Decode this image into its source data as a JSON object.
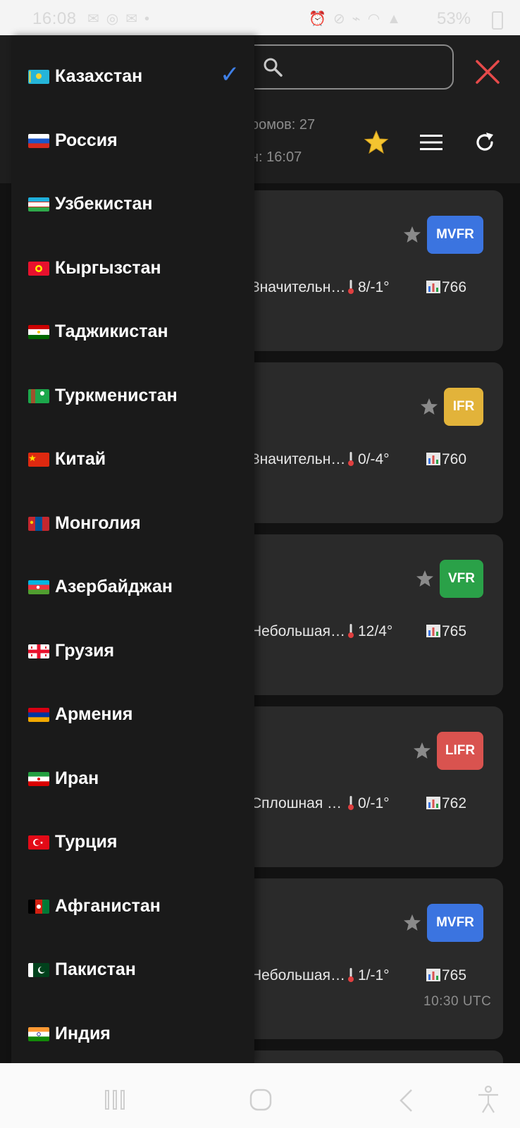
{
  "status_bar": {
    "time": "16:08",
    "battery": "53%",
    "left_icons": [
      "mail-icon",
      "instagram-icon",
      "message-icon",
      "dot-icon"
    ],
    "right_icons": [
      "alarm-icon",
      "no-sound-icon",
      "wifi-calling-icon",
      "wifi-icon",
      "signal-icon"
    ]
  },
  "header": {
    "search_value": "",
    "info_line1": "ромов: 27",
    "info_line2": "н: 16:07",
    "colors": {
      "favorite_star": "#f4c430",
      "close": "#e64a4a"
    }
  },
  "cards": [
    {
      "badge": "MVFR",
      "badge_color": "#3b74e0",
      "desc": "Значительн…",
      "temp": "8/-1°",
      "pressure": "766",
      "utc": ""
    },
    {
      "badge": "IFR",
      "badge_color": "#e2b33a",
      "desc": "Значительн…",
      "temp": "0/-4°",
      "pressure": "760",
      "utc": ""
    },
    {
      "badge": "VFR",
      "badge_color": "#2aa148",
      "desc": "Небольшая…",
      "temp": "12/4°",
      "pressure": "765",
      "utc": ""
    },
    {
      "badge": "LIFR",
      "badge_color": "#d9534f",
      "desc": "Сплошная …",
      "temp": "0/-1°",
      "pressure": "762",
      "utc": ""
    },
    {
      "badge": "MVFR",
      "badge_color": "#3b74e0",
      "desc": "Небольшая…",
      "temp": "1/-1°",
      "pressure": "765",
      "utc": "10:30 UTC"
    }
  ],
  "drawer": {
    "selected_index": 0,
    "check_color": "#3f7fe6",
    "countries": [
      {
        "name": "Казахстан",
        "flag": "kz"
      },
      {
        "name": "Россия",
        "flag": "ru"
      },
      {
        "name": "Узбекистан",
        "flag": "uz"
      },
      {
        "name": "Кыргызстан",
        "flag": "kg"
      },
      {
        "name": "Таджикистан",
        "flag": "tj"
      },
      {
        "name": "Туркменистан",
        "flag": "tm"
      },
      {
        "name": "Китай",
        "flag": "cn"
      },
      {
        "name": "Монголия",
        "flag": "mn"
      },
      {
        "name": "Азербайджан",
        "flag": "az"
      },
      {
        "name": "Грузия",
        "flag": "ge"
      },
      {
        "name": "Армения",
        "flag": "am"
      },
      {
        "name": "Иран",
        "flag": "ir"
      },
      {
        "name": "Турция",
        "flag": "tr"
      },
      {
        "name": "Афганистан",
        "flag": "af"
      },
      {
        "name": "Пакистан",
        "flag": "pk"
      },
      {
        "name": "Индия",
        "flag": "in"
      }
    ]
  },
  "nav_bar": {
    "buttons": [
      "recent-apps-icon",
      "home-icon",
      "back-icon",
      "accessibility-icon"
    ]
  }
}
